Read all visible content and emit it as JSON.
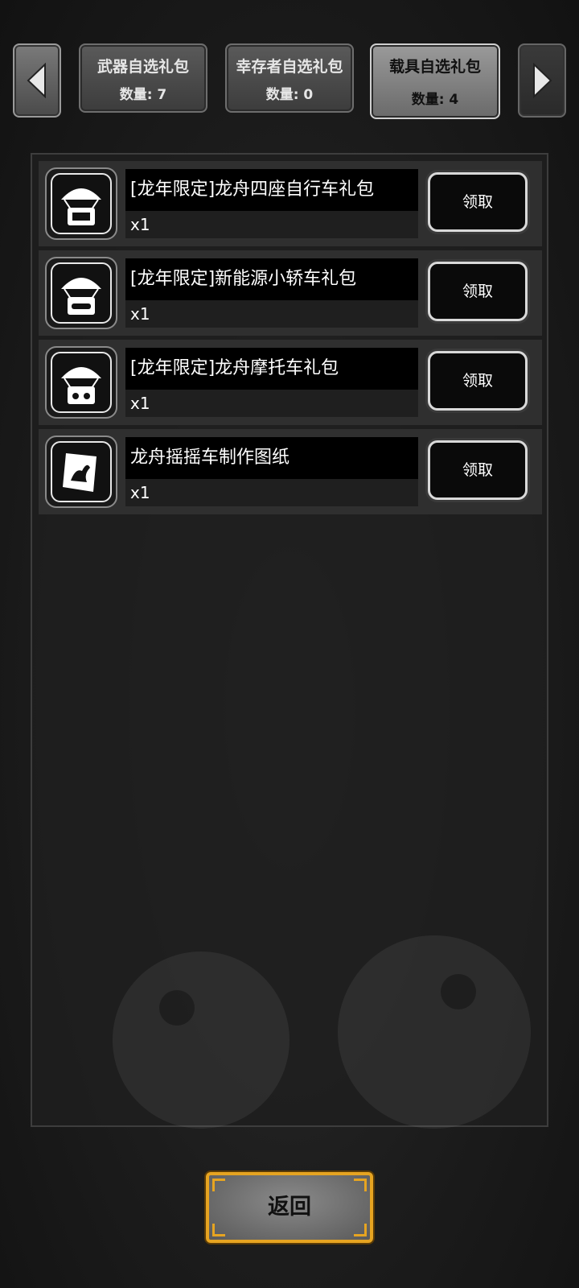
{
  "tabs": [
    {
      "label": "武器自选礼包",
      "count": "数量: 7"
    },
    {
      "label": "幸存者自选礼包",
      "count": "数量: 0"
    },
    {
      "label": "载具自选礼包",
      "count": "数量: 4"
    }
  ],
  "items": [
    {
      "name": "[龙年限定]龙舟四座自行车礼包",
      "qty": "x1",
      "button": "领取",
      "icon": "parachute-crate-icon"
    },
    {
      "name": "[龙年限定]新能源小轿车礼包",
      "qty": "x1",
      "button": "领取",
      "icon": "parachute-crate-icon"
    },
    {
      "name": "[龙年限定]龙舟摩托车礼包",
      "qty": "x1",
      "button": "领取",
      "icon": "parachute-crate-icon"
    },
    {
      "name": "龙舟摇摇车制作图纸",
      "qty": "x1",
      "button": "领取",
      "icon": "blueprint-icon"
    }
  ],
  "back_label": "返回",
  "colors": {
    "accent_gold": "#e6a421",
    "panel": "#2f2f2f"
  }
}
